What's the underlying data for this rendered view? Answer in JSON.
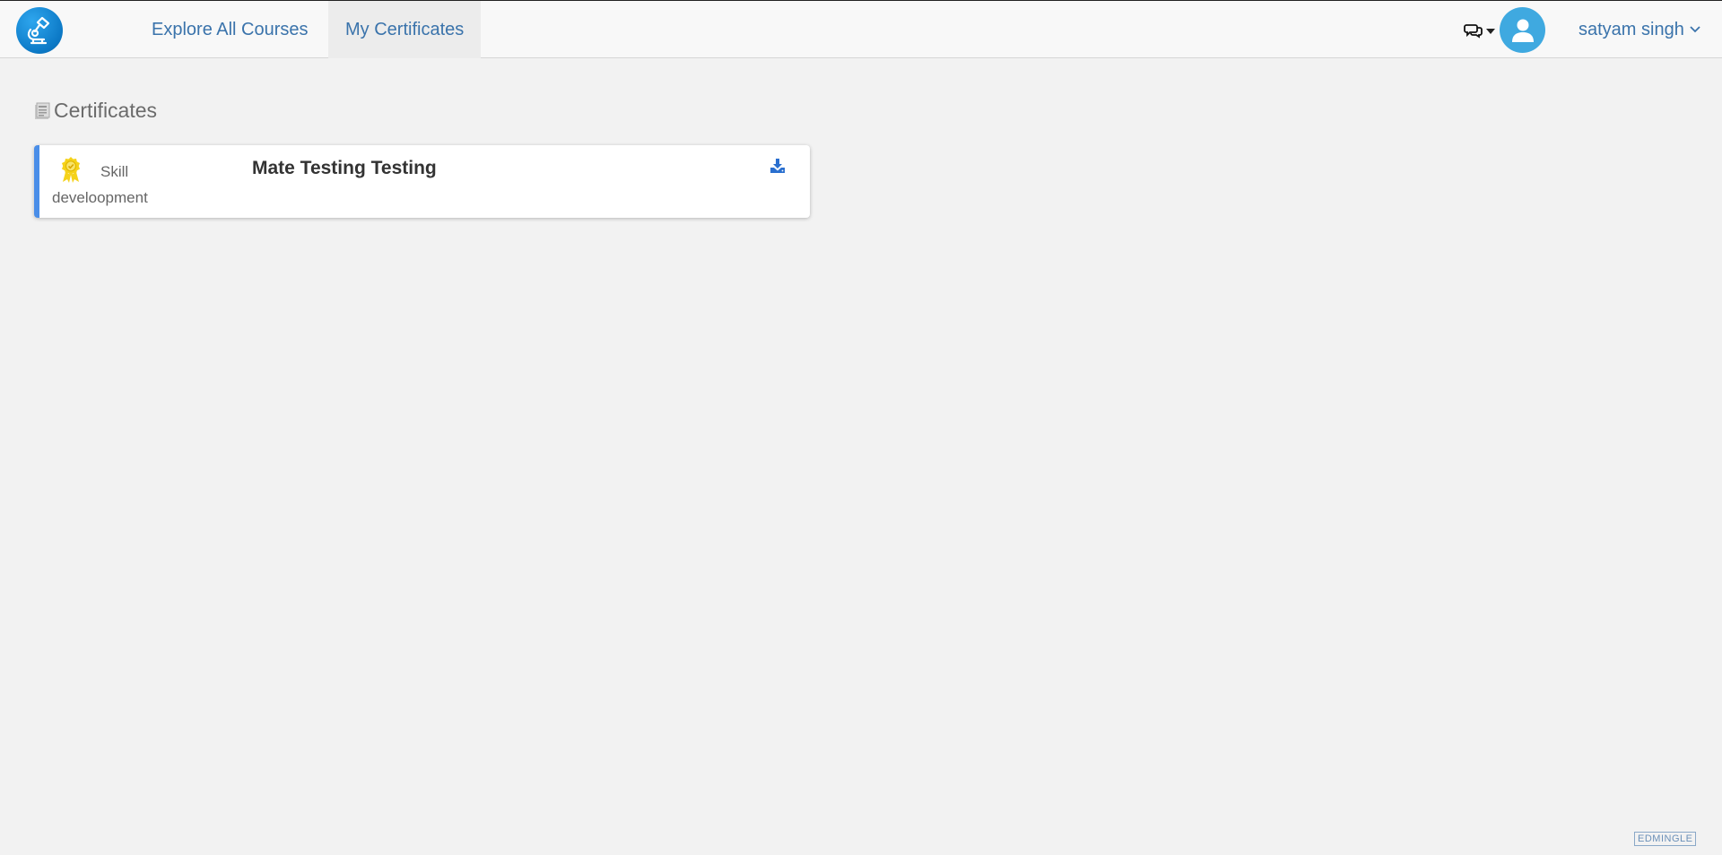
{
  "nav": {
    "logo_icon": "microscope-logo-icon",
    "links": [
      {
        "label": "Explore All Courses"
      },
      {
        "label": "My Certificates"
      }
    ],
    "chat_icon": "chat-bubbles-icon",
    "avatar_icon": "user-avatar-icon",
    "user_name": "satyam singh"
  },
  "page": {
    "section_title": "Certificates",
    "section_icon": "certificate-list-icon"
  },
  "certificates": [
    {
      "category": "Skill develoopment",
      "title": "Mate Testing Testing",
      "badge_icon": "award-badge-icon",
      "download_icon": "download-icon"
    }
  ],
  "footer": {
    "watermark": "EDMINGLE"
  },
  "colors": {
    "link": "#3a73ab",
    "accent": "#4a8ee8",
    "avatar": "#3fa9e0",
    "badge": "#f5d21a"
  }
}
